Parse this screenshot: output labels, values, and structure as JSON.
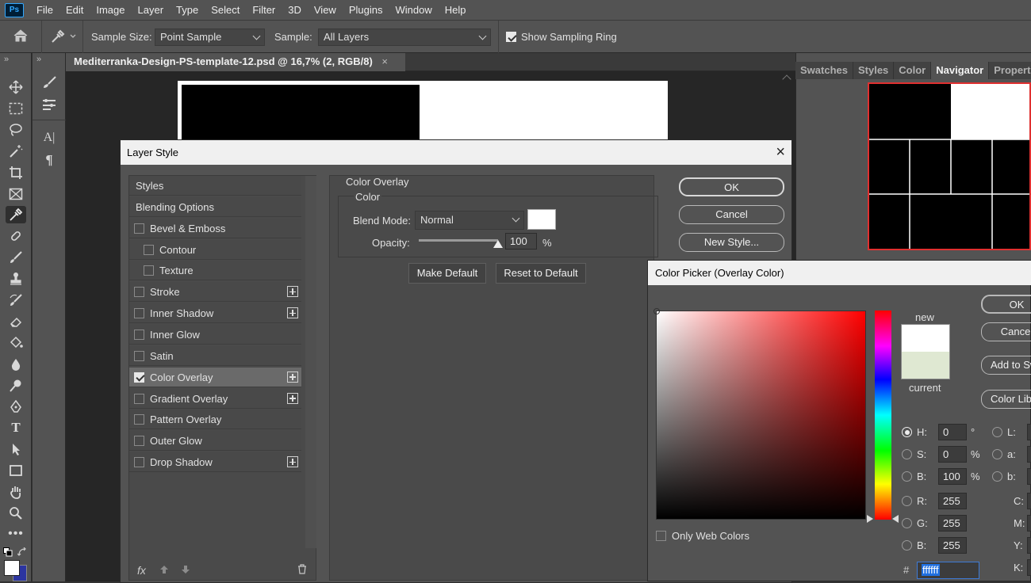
{
  "menubar": {
    "logo": "Ps",
    "items": [
      "File",
      "Edit",
      "Image",
      "Layer",
      "Type",
      "Select",
      "Filter",
      "3D",
      "View",
      "Plugins",
      "Window",
      "Help"
    ]
  },
  "options": {
    "sample_size_label": "Sample Size:",
    "sample_size_value": "Point Sample",
    "sample_label": "Sample:",
    "sample_value": "All Layers",
    "show_ring_label": "Show Sampling Ring",
    "show_ring_checked": true
  },
  "document": {
    "tab_title": "Mediterranka-Design-PS-template-12.psd @ 16,7% (2, RGB/8)",
    "close_glyph": "×"
  },
  "panels": {
    "tabs": [
      "Swatches",
      "Styles",
      "Color",
      "Navigator",
      "Properties"
    ],
    "active": "Navigator"
  },
  "layer_style": {
    "title": "Layer Style",
    "close_glyph": "×",
    "list": [
      {
        "label": "Styles",
        "checkbox": false,
        "plus": false,
        "indent": false,
        "checked": false
      },
      {
        "label": "Blending Options",
        "checkbox": false,
        "plus": false,
        "indent": false,
        "checked": false
      },
      {
        "label": "Bevel & Emboss",
        "checkbox": true,
        "plus": false,
        "indent": false,
        "checked": false
      },
      {
        "label": "Contour",
        "checkbox": true,
        "plus": false,
        "indent": true,
        "checked": false
      },
      {
        "label": "Texture",
        "checkbox": true,
        "plus": false,
        "indent": true,
        "checked": false
      },
      {
        "label": "Stroke",
        "checkbox": true,
        "plus": true,
        "indent": false,
        "checked": false
      },
      {
        "label": "Inner Shadow",
        "checkbox": true,
        "plus": true,
        "indent": false,
        "checked": false
      },
      {
        "label": "Inner Glow",
        "checkbox": true,
        "plus": false,
        "indent": false,
        "checked": false
      },
      {
        "label": "Satin",
        "checkbox": true,
        "plus": false,
        "indent": false,
        "checked": false
      },
      {
        "label": "Color Overlay",
        "checkbox": true,
        "plus": true,
        "indent": false,
        "checked": true
      },
      {
        "label": "Gradient Overlay",
        "checkbox": true,
        "plus": true,
        "indent": false,
        "checked": false
      },
      {
        "label": "Pattern Overlay",
        "checkbox": true,
        "plus": false,
        "indent": false,
        "checked": false
      },
      {
        "label": "Outer Glow",
        "checkbox": true,
        "plus": false,
        "indent": false,
        "checked": false
      },
      {
        "label": "Drop Shadow",
        "checkbox": true,
        "plus": true,
        "indent": false,
        "checked": false
      }
    ],
    "fx_label": "fx",
    "section_title": "Color Overlay",
    "group_title": "Color",
    "blend_mode_label": "Blend Mode:",
    "blend_mode_value": "Normal",
    "overlay_color": "#ffffff",
    "opacity_label": "Opacity:",
    "opacity_value": "100",
    "opacity_unit": "%",
    "opacity_fraction": 1.0,
    "make_default": "Make Default",
    "reset_default": "Reset to Default",
    "ok": "OK",
    "cancel": "Cancel",
    "new_style": "New Style..."
  },
  "color_picker": {
    "title": "Color Picker (Overlay Color)",
    "new_label": "new",
    "current_label": "current",
    "new_color": "#ffffff",
    "current_color": "#dfe8d2",
    "ok": "OK",
    "cancel": "Cancel",
    "add_swatches": "Add to Swatches",
    "color_libraries": "Color Libraries",
    "only_web_colors": "Only Web Colors",
    "hsb": [
      {
        "label": "H:",
        "value": "0",
        "unit": "°",
        "selected": true
      },
      {
        "label": "S:",
        "value": "0",
        "unit": "%",
        "selected": false
      },
      {
        "label": "B:",
        "value": "100",
        "unit": "%",
        "selected": false
      }
    ],
    "rgb": [
      {
        "label": "R:",
        "value": "255"
      },
      {
        "label": "G:",
        "value": "255"
      },
      {
        "label": "B:",
        "value": "255"
      }
    ],
    "lab": [
      "L:",
      "a:",
      "b:"
    ],
    "cmyk": [
      "C:",
      "M:",
      "Y:",
      "K:"
    ],
    "hex_label": "#",
    "hex_value": "ffffff"
  }
}
